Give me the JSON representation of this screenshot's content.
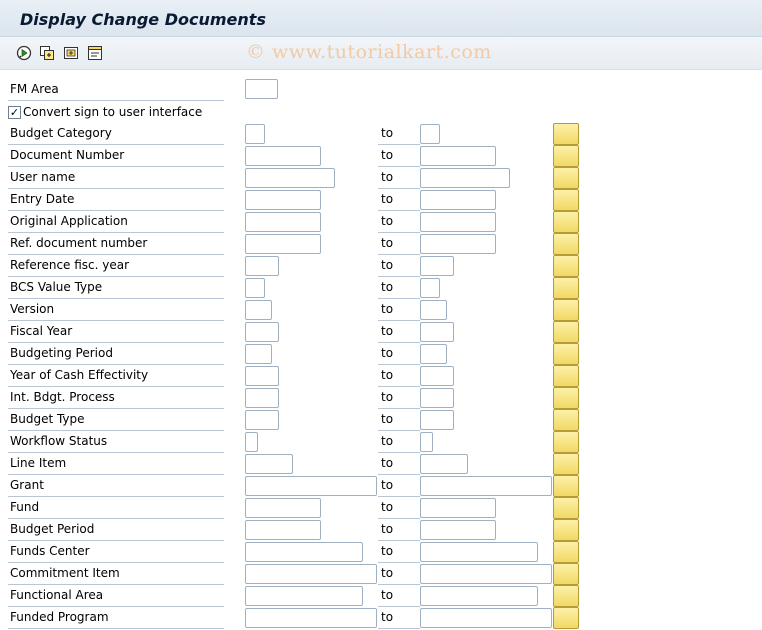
{
  "window": {
    "title": "Display Change Documents"
  },
  "watermark": "© www.tutorialkart.com",
  "toolbar": {
    "icons": [
      "execute-icon",
      "get-variant-icon",
      "save-variant-icon",
      "selection-options-icon"
    ]
  },
  "fm_area": {
    "label": "FM Area",
    "value": ""
  },
  "convert_sign": {
    "label": "Convert sign to user interface",
    "checked": true,
    "mark": "✓"
  },
  "to_label": "to",
  "rows": [
    {
      "label": "Budget Category",
      "from": "",
      "to": ""
    },
    {
      "label": "Document Number",
      "from": "",
      "to": ""
    },
    {
      "label": "User name",
      "from": "",
      "to": ""
    },
    {
      "label": "Entry Date",
      "from": "",
      "to": ""
    },
    {
      "label": "Original Application",
      "from": "",
      "to": ""
    },
    {
      "label": "Ref. document number",
      "from": "",
      "to": ""
    },
    {
      "label": "Reference fisc. year",
      "from": "",
      "to": ""
    },
    {
      "label": "BCS Value Type",
      "from": "",
      "to": ""
    },
    {
      "label": "Version",
      "from": "",
      "to": ""
    },
    {
      "label": "Fiscal Year",
      "from": "",
      "to": ""
    },
    {
      "label": "Budgeting Period",
      "from": "",
      "to": ""
    },
    {
      "label": "Year of Cash Effectivity",
      "from": "",
      "to": ""
    },
    {
      "label": "Int. Bdgt. Process",
      "from": "",
      "to": ""
    },
    {
      "label": "Budget Type",
      "from": "",
      "to": ""
    },
    {
      "label": "Workflow Status",
      "from": "",
      "to": ""
    },
    {
      "label": "Line Item",
      "from": "",
      "to": ""
    },
    {
      "label": "Grant",
      "from": "",
      "to": ""
    },
    {
      "label": "Fund",
      "from": "",
      "to": ""
    },
    {
      "label": "Budget Period",
      "from": "",
      "to": ""
    },
    {
      "label": "Funds Center",
      "from": "",
      "to": ""
    },
    {
      "label": "Commitment Item",
      "from": "",
      "to": ""
    },
    {
      "label": "Functional Area",
      "from": "",
      "to": ""
    },
    {
      "label": "Funded Program",
      "from": "",
      "to": ""
    }
  ]
}
